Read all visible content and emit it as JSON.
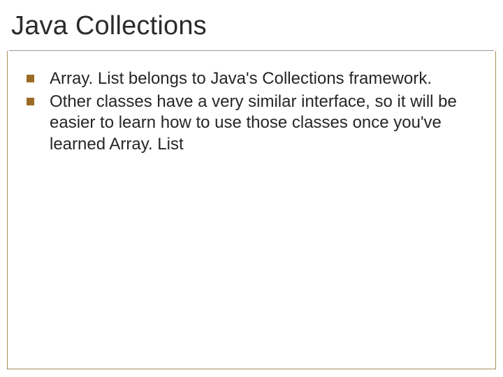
{
  "slide": {
    "title": "Java Collections",
    "bullets": [
      {
        "text": "Array. List belongs to Java's Collections framework."
      },
      {
        "text": "Other classes have a very similar interface, so it will be easier to learn how to use those classes once you've learned Array. List"
      }
    ]
  }
}
